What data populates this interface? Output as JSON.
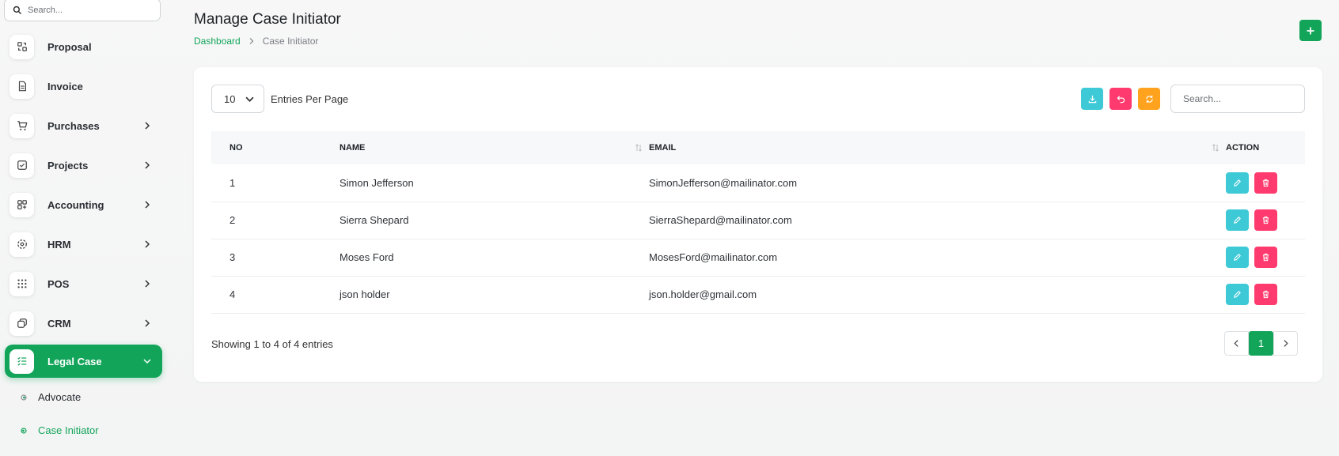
{
  "sidebar": {
    "search_placeholder": "Search...",
    "items": [
      {
        "label": "Proposal",
        "icon": "proposal-icon",
        "has_chevron": false
      },
      {
        "label": "Invoice",
        "icon": "invoice-icon",
        "has_chevron": false
      },
      {
        "label": "Purchases",
        "icon": "cart-icon",
        "has_chevron": true
      },
      {
        "label": "Projects",
        "icon": "projects-icon",
        "has_chevron": true
      },
      {
        "label": "Accounting",
        "icon": "accounting-icon",
        "has_chevron": true
      },
      {
        "label": "HRM",
        "icon": "hrm-icon",
        "has_chevron": true
      },
      {
        "label": "POS",
        "icon": "pos-icon",
        "has_chevron": true
      },
      {
        "label": "CRM",
        "icon": "crm-icon",
        "has_chevron": true
      },
      {
        "label": "Legal Case",
        "icon": "legal-case-icon",
        "has_chevron": true,
        "active": true
      }
    ],
    "sub_items": [
      {
        "label": "Advocate",
        "current": false
      },
      {
        "label": "Case Initiator",
        "current": true
      }
    ]
  },
  "header": {
    "title": "Manage Case Initiator",
    "breadcrumb": {
      "home": "Dashboard",
      "current": "Case Initiator"
    },
    "add_icon": "plus-icon"
  },
  "toolbar": {
    "entries_value": "10",
    "entries_label": "Entries Per Page",
    "search_placeholder": "Search...",
    "buttons": [
      "download-icon",
      "undo-icon",
      "refresh-icon"
    ]
  },
  "table": {
    "columns": [
      "NO",
      "NAME",
      "EMAIL",
      "ACTION"
    ],
    "rows": [
      {
        "no": "1",
        "name": "Simon Jefferson",
        "email": "SimonJefferson@mailinator.com"
      },
      {
        "no": "2",
        "name": "Sierra Shepard",
        "email": "SierraShepard@mailinator.com"
      },
      {
        "no": "3",
        "name": "Moses Ford",
        "email": "MosesFord@mailinator.com"
      },
      {
        "no": "4",
        "name": "json holder",
        "email": "json.holder@gmail.com"
      }
    ]
  },
  "footer": {
    "info": "Showing 1 to 4 of 4 entries",
    "current_page": "1"
  },
  "colors": {
    "accent": "#12a55a",
    "edit": "#3ec9d6",
    "delete": "#ff3a6e",
    "warning": "#ffa21d"
  }
}
